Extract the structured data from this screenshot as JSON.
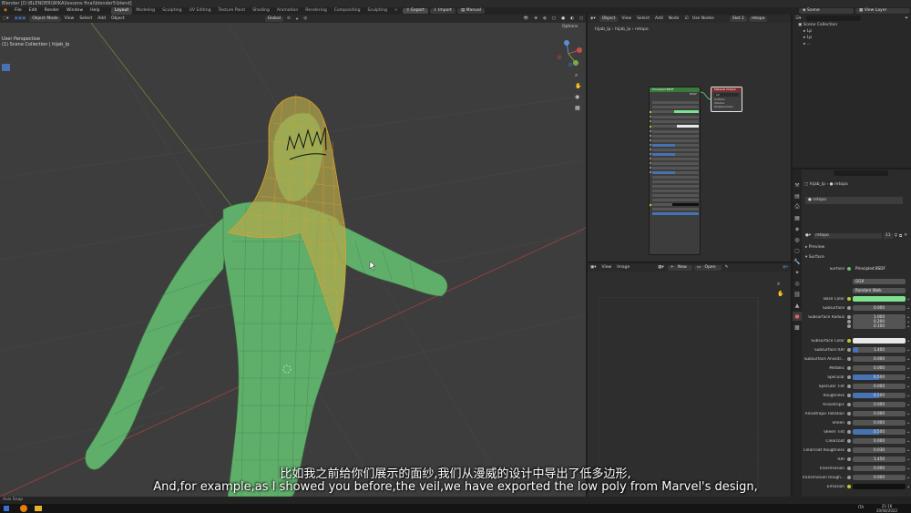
{
  "title_bar": "Blender [D:\\BLENDER\\WIKA\\lessons final\\blender5\\blend]",
  "menu": {
    "items": [
      "File",
      "Edit",
      "Render",
      "Window",
      "Help"
    ],
    "workspaces": [
      "Layout",
      "Modeling",
      "Sculpting",
      "UV Editing",
      "Texture Paint",
      "Shading",
      "Animation",
      "Rendering",
      "Compositing",
      "Sculpting"
    ],
    "active_workspace": "Layout",
    "export_label": "Export",
    "import_label": "Import",
    "manual_label": "Manual",
    "scene_label": "Scene",
    "view_layer_label": "View Layer"
  },
  "viewport": {
    "mode": "Object Mode",
    "menus": [
      "View",
      "Select",
      "Add",
      "Object"
    ],
    "transform": "Global",
    "overlay_title": "User Perspective",
    "overlay_sub": "(1) Scene Collection | hijab_lp",
    "options_label": "Options"
  },
  "node_editor": {
    "object_label": "Object",
    "menus": [
      "View",
      "Select",
      "Add",
      "Node"
    ],
    "use_nodes_label": "Use Nodes",
    "slot_label": "Slot 1",
    "material": "retopo",
    "breadcrumb": [
      "hijab_lp",
      "hijab_lp",
      "retopo"
    ],
    "bsdf_title": "Principled BSDF",
    "output_title": "Material Output",
    "bsdf_output": "BSDF",
    "output_target": "All",
    "output_sockets": [
      "Surface",
      "Volume",
      "Displacement"
    ]
  },
  "image_editor": {
    "menus": [
      "View",
      "Image"
    ],
    "new_label": "New",
    "open_label": "Open"
  },
  "outliner": {
    "collection": "Scene Collection",
    "items": [
      "Lp",
      "Lp",
      "..."
    ]
  },
  "properties": {
    "breadcrumb": [
      "hijab_lp",
      "retopo"
    ],
    "material_slot": "retopo",
    "material_name": "retopo",
    "user_count": "11",
    "preview_label": "Preview",
    "surface_panel": "Surface",
    "surface_label": "Surface",
    "surface_value": "Principled BSDF",
    "distribution": "GGX",
    "sss_method": "Random Walk",
    "rows": [
      {
        "label": "Base Color",
        "type": "color",
        "value": "",
        "color": "#7ee08f"
      },
      {
        "label": "Subsurface",
        "type": "num",
        "value": "0.000"
      },
      {
        "label": "Subsurface Radius",
        "type": "num",
        "value": "1.000"
      },
      {
        "label": "",
        "type": "num",
        "value": "0.200"
      },
      {
        "label": "",
        "type": "num",
        "value": "0.100"
      },
      {
        "label": "Subsurface Color",
        "type": "color",
        "value": "",
        "color": "#e8e8e8"
      },
      {
        "label": "Subsurface IOR",
        "type": "slider",
        "value": "1.400",
        "fill": 0.1
      },
      {
        "label": "Subsurface Anisotr...",
        "type": "num",
        "value": "0.000"
      },
      {
        "label": "Metallic",
        "type": "num",
        "value": "0.000"
      },
      {
        "label": "Specular",
        "type": "slider",
        "value": "0.500",
        "fill": 0.5
      },
      {
        "label": "Specular Tint",
        "type": "num",
        "value": "0.000"
      },
      {
        "label": "Roughness",
        "type": "slider",
        "value": "0.500",
        "fill": 0.5
      },
      {
        "label": "Anisotropic",
        "type": "num",
        "value": "0.000"
      },
      {
        "label": "Anisotropic Rotation",
        "type": "num",
        "value": "0.000"
      },
      {
        "label": "Sheen",
        "type": "num",
        "value": "0.000"
      },
      {
        "label": "Sheen Tint",
        "type": "slider",
        "value": "0.500",
        "fill": 0.5
      },
      {
        "label": "Clearcoat",
        "type": "num",
        "value": "0.000"
      },
      {
        "label": "Clearcoat Roughness",
        "type": "num",
        "value": "0.030"
      },
      {
        "label": "IOR",
        "type": "num",
        "value": "1.450"
      },
      {
        "label": "Transmission",
        "type": "num",
        "value": "0.000"
      },
      {
        "label": "Transmission Rough...",
        "type": "num",
        "value": "0.000"
      },
      {
        "label": "Emission",
        "type": "color",
        "value": "",
        "color": "#111111"
      }
    ]
  },
  "status_bar": {
    "left": "Axis Snap"
  },
  "taskbar": {
    "time": "21:16",
    "date": "20/04/2022",
    "lang": "ITA"
  },
  "subtitles": {
    "zh": "比如我之前给你们展示的面纱,我们从漫威的设计中导出了低多边形,",
    "en": "And,for example,as I showed you before,the veil,we have exported the low poly from Marvel's design,"
  },
  "colors": {
    "mesh_green": "#5fae6a",
    "wire_orange": "#e0a030",
    "accent_blue": "#4772b3"
  }
}
